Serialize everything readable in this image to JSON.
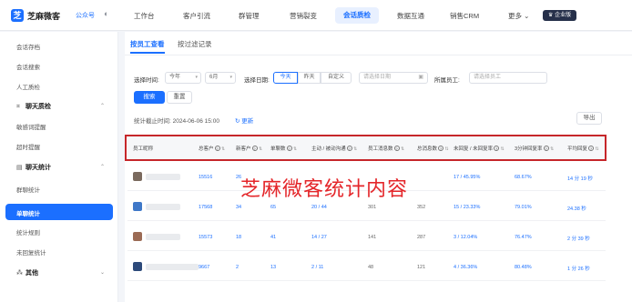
{
  "app": {
    "brand": "芝麻微客",
    "account": "公众号",
    "badge": "企业版"
  },
  "nav": [
    {
      "label": "工作台"
    },
    {
      "label": "客户引流"
    },
    {
      "label": "群管理"
    },
    {
      "label": "营销裂变"
    },
    {
      "label": "会话质检",
      "active": true
    },
    {
      "label": "数据互通"
    },
    {
      "label": "销售CRM"
    }
  ],
  "nav_more": "更多",
  "sidebar": {
    "items": [
      {
        "label": "会话存档"
      },
      {
        "label": "会话搜索"
      },
      {
        "label": "人工质检"
      }
    ],
    "group1": {
      "label": "聊天质检"
    },
    "group1_items": [
      {
        "label": "敏感词提醒"
      },
      {
        "label": "超时提醒"
      }
    ],
    "group2": {
      "label": "聊天统计"
    },
    "group2_items": [
      {
        "label": "群聊统计"
      },
      {
        "label": "单聊统计"
      },
      {
        "label": "统计规则"
      },
      {
        "label": "未回复统计"
      }
    ],
    "group3": {
      "label": "其他"
    }
  },
  "tabs": [
    {
      "label": "按员工查看"
    },
    {
      "label": "按过滤记录"
    }
  ],
  "filters": {
    "time_label": "选择时间:",
    "year": "今年",
    "month": "6月",
    "date_label": "选择日期:",
    "seg_today": "今天",
    "seg_yesterday": "昨天",
    "seg_custom": "自定义",
    "date_placeholder": "请选择日期",
    "emp_label": "所属员工:",
    "emp_placeholder": "请选择员工"
  },
  "actions": {
    "search": "搜索",
    "reset": "重置",
    "export": "导出"
  },
  "stats": {
    "deadline": "统计截止时间: 2024-06-06 15:00",
    "refresh": "更新"
  },
  "table": {
    "headers": [
      "员工昵称",
      "总客户",
      "新客户",
      "单聊数",
      "主动 / 被动沟通",
      "员工消息数",
      "总消息数",
      "未回复 / 未回复率",
      "3分钟回复率",
      "平均回复"
    ],
    "rows": [
      {
        "total": "15516",
        "new": "26",
        "single": "",
        "active": "",
        "staff_msg": "",
        "total_msg": "",
        "unreplied": "17 / 45.95%",
        "rate3": "68.67%",
        "avg": "14 分 19 秒"
      },
      {
        "total": "17568",
        "new": "34",
        "single": "65",
        "active": "20 / 44",
        "staff_msg": "301",
        "total_msg": "352",
        "unreplied": "15 / 23.33%",
        "rate3": "79.01%",
        "avg": "24.38 秒"
      },
      {
        "total": "15573",
        "new": "18",
        "single": "41",
        "active": "14 / 27",
        "staff_msg": "141",
        "total_msg": "287",
        "unreplied": "3 / 12.04%",
        "rate3": "76.47%",
        "avg": "2 分 39 秒"
      },
      {
        "total": "9667",
        "new": "2",
        "single": "13",
        "active": "2 / 11",
        "staff_msg": "48",
        "total_msg": "121",
        "unreplied": "4 / 36.36%",
        "rate3": "80.48%",
        "avg": "1 分 26 秒"
      }
    ]
  },
  "overlay": {
    "watermark": "芝麻微客统计内容"
  },
  "colors": {
    "accent": "#1b6fff",
    "highlight": "#c6262a",
    "watermark": "#e4262a"
  }
}
